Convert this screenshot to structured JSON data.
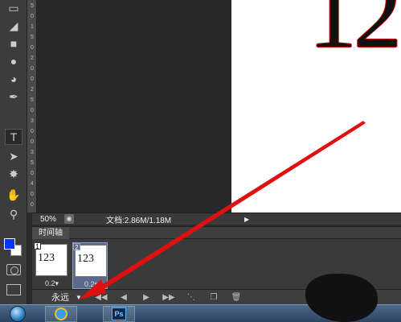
{
  "toolbar": {
    "tools": [
      "marquee-icon",
      "eraser-icon",
      "gradient-icon",
      "blur-icon",
      "dodge-icon",
      "pen-icon",
      "type-icon",
      "path-select-icon",
      "shape-icon",
      "hand-icon",
      "zoom-icon"
    ],
    "type_tool_glyph": "T",
    "foreground_color": "#0033ff",
    "background_color": "#ffffff"
  },
  "ruler": {
    "ticks": [
      "5",
      "0",
      "1",
      "5",
      "0",
      "2",
      "0",
      "0",
      "2",
      "5",
      "0",
      "3",
      "0",
      "0",
      "3",
      "5",
      "0",
      "4",
      "0",
      "0"
    ]
  },
  "canvas": {
    "big_text": "12"
  },
  "status": {
    "zoom": "50%",
    "doc_info": "文档:2.86M/1.18M"
  },
  "timeline": {
    "title": "时间轴",
    "frames": [
      {
        "number": "1",
        "content": "123",
        "delay": "0.2▾"
      },
      {
        "number": "2",
        "content": "123",
        "delay": "0.2▾"
      }
    ],
    "loop_value": "永远"
  },
  "colors": {
    "annotation_arrow": "#e01010",
    "selected_frame": "#5a6a8a"
  }
}
